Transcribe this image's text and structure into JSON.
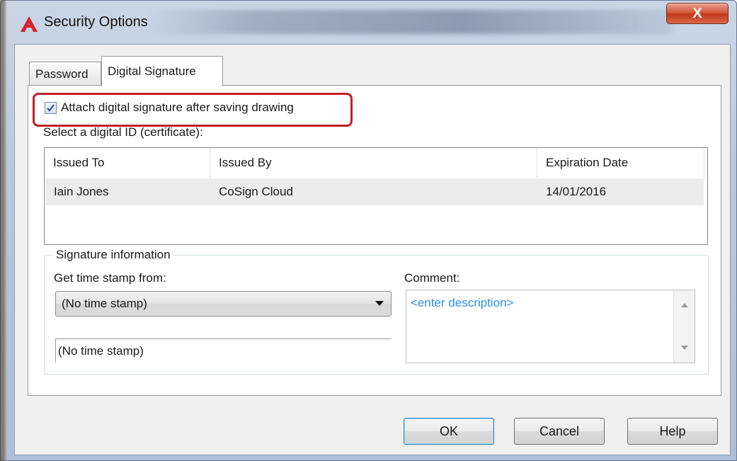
{
  "window": {
    "title": "Security Options",
    "close_glyph": "X",
    "app_icon": "autocad-a-icon",
    "accent_color": "#c0202a"
  },
  "tabs": [
    {
      "label": "Password",
      "active": false
    },
    {
      "label": "Digital Signature",
      "active": true
    }
  ],
  "digital_signature": {
    "attach_checkbox": {
      "label": "Attach digital signature after saving drawing",
      "checked": true
    },
    "select_id_label": "Select a digital ID (certificate):",
    "table": {
      "columns": [
        "Issued To",
        "Issued By",
        "Expiration Date"
      ],
      "rows": [
        {
          "issued_to": "Iain Jones",
          "issued_by": "CoSign Cloud",
          "expiration": "14/01/2016"
        }
      ]
    },
    "signature_info": {
      "legend": "Signature information",
      "timestamp_label": "Get time stamp from:",
      "timestamp_selected": "(No time stamp)",
      "timestamp_display": "(No time stamp)",
      "comment_label": "Comment:",
      "comment_placeholder": "<enter description>"
    }
  },
  "buttons": {
    "ok": "OK",
    "cancel": "Cancel",
    "help": "Help"
  }
}
